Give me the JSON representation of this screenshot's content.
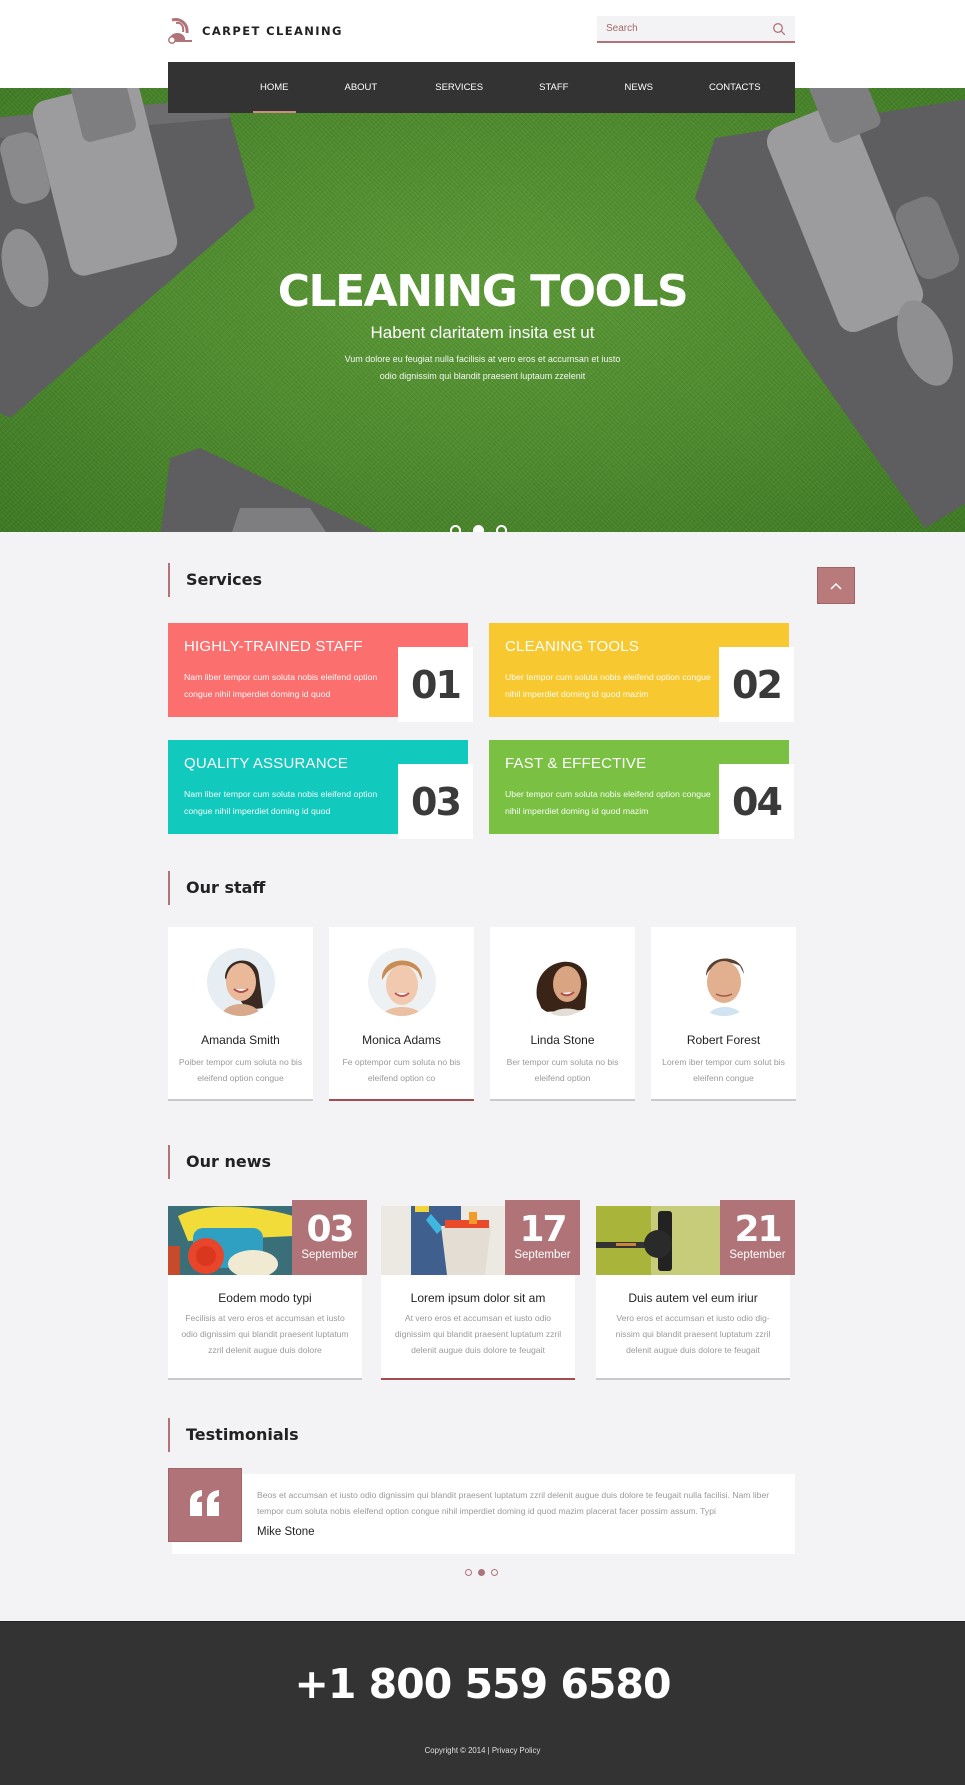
{
  "header": {
    "logo_text": "CARPET CLEANING",
    "search_placeholder": "Search",
    "accent_color": "#b07478"
  },
  "nav": {
    "items": [
      {
        "label": "HOME",
        "active": true
      },
      {
        "label": "ABOUT"
      },
      {
        "label": "SERVICES"
      },
      {
        "label": "STAFF"
      },
      {
        "label": "NEWS"
      },
      {
        "label": "CONTACTS"
      }
    ]
  },
  "hero": {
    "title": "CLEANING TOOLS",
    "subtitle": "Habent claritatem insita est ut",
    "text": "Vum dolore eu feugiat nulla facilisis at vero eros et accumsan et iusto odio dignissim qui blandit praesent luptaum zzelenit",
    "slides": 3,
    "active_slide": 2
  },
  "services": {
    "title": "Services",
    "items": [
      {
        "title": "HIGHLY-TRAINED STAFF",
        "text": "Nam liber tempor cum soluta nobis eleifend option congue nihil imperdiet doming id quod",
        "number": "01",
        "color": "#fc6f6f"
      },
      {
        "title": "CLEANING TOOLS",
        "text": "Uber tempor cum soluta nobis eleifend option congue nihil imperdiet doming id quod mazim",
        "number": "02",
        "color": "#f7c82f"
      },
      {
        "title": "QUALITY ASSURANCE",
        "text": "Nam liber tempor cum soluta nobis eleifend option congue nihil imperdiet doming id quod",
        "number": "03",
        "color": "#11c9bd"
      },
      {
        "title": "FAST & EFFECTIVE",
        "text": "Uber tempor cum soluta nobis eleifend option congue nihil imperdiet doming id quod mazim",
        "number": "04",
        "color": "#7ac143"
      }
    ]
  },
  "staff": {
    "title": "Our staff",
    "members": [
      {
        "name": "Amanda Smith",
        "text": "Poiber tempor cum soluta no bis eleifend option congue"
      },
      {
        "name": "Monica Adams",
        "text": "Fe optempor cum soluta no bis eleifend option co"
      },
      {
        "name": "Linda Stone",
        "text": "Ber tempor cum soluta no bis eleifend option"
      },
      {
        "name": "Robert Forest",
        "text": "Lorem iber tempor cum solut bis eleifenn congue"
      }
    ]
  },
  "news": {
    "title": "Our news",
    "items": [
      {
        "day": "03",
        "month": "September",
        "title": "Eodem modo typi",
        "text": "Fecilisis at vero eros et accumsan et iusto odio dignissim qui blandit praesent luptatum zzril delenit augue duis dolore"
      },
      {
        "day": "17",
        "month": "September",
        "title": "Lorem ipsum dolor sit am",
        "text": "At vero eros et accumsan et iusto odio dignissim qui blandit praesent luptatum zzril delenit augue duis dolore te feugait"
      },
      {
        "day": "21",
        "month": "September",
        "title": "Duis autem vel eum iriur",
        "text": "Vero eros et accumsan et iusto odio dig-nissim qui blandit praesent luptatum zzril delenit augue duis dolore te feugait"
      }
    ]
  },
  "testimonials": {
    "title": "Testimonials",
    "text": "Beos et accumsan et iusto odio dignissim qui blandit praesent luptatum zzril delenit augue duis dolore te feugait nulla facilisi. Nam liber tempor cum soluta nobis eleifend option congue nihil imperdiet doming id quod mazim placerat facer possim assum. Typi",
    "author": "Mike Stone",
    "slides": 3,
    "active_slide": 2
  },
  "footer": {
    "phone": "+1 800 559 6580",
    "copyright": "Copyright © 2014",
    "separator": "|",
    "privacy_link": "Privacy Policy"
  }
}
